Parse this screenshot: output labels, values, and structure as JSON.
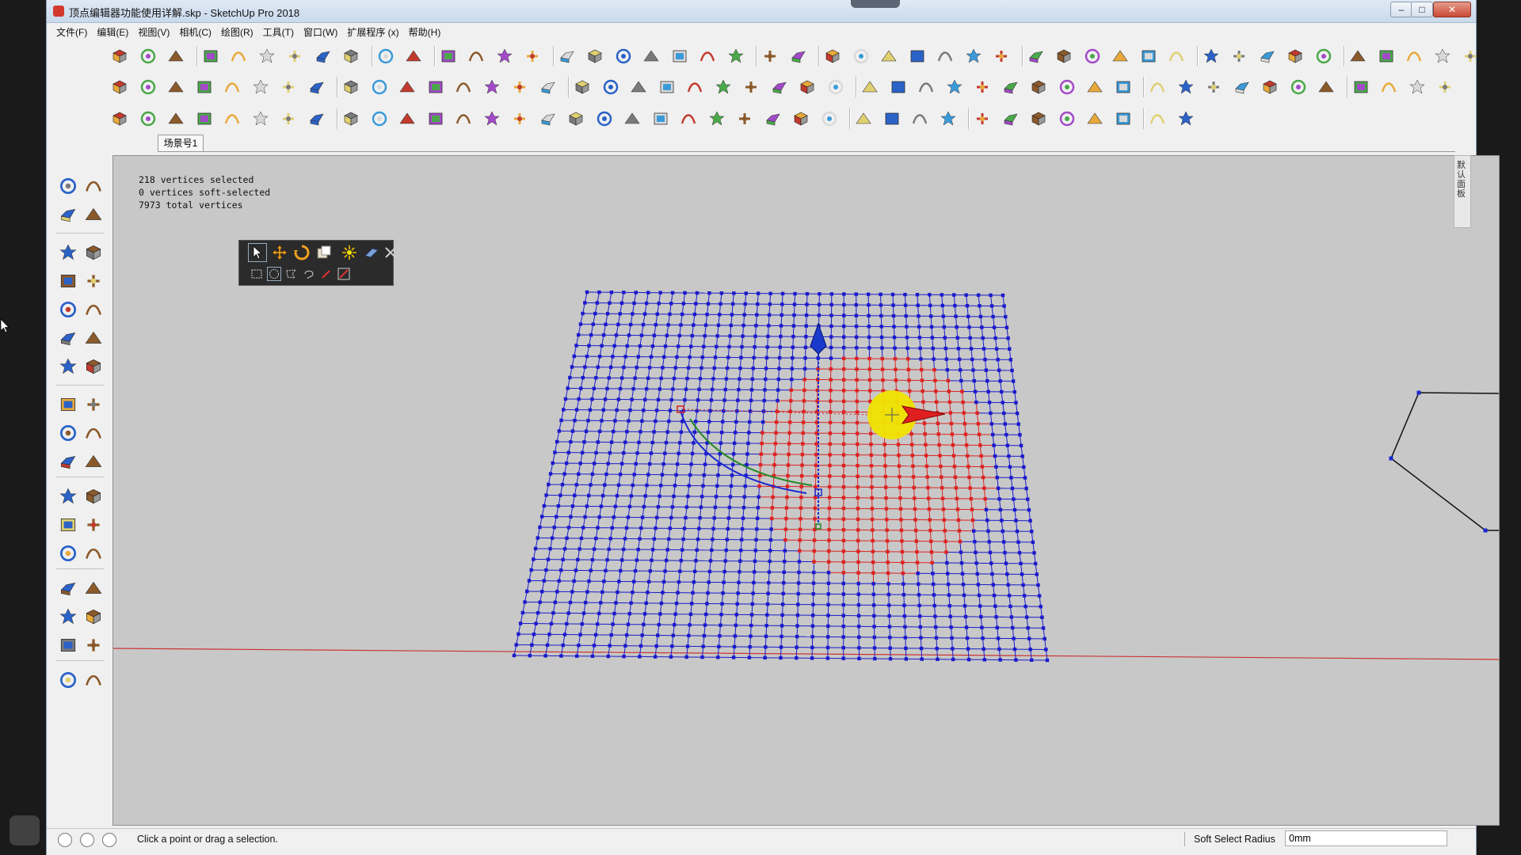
{
  "window": {
    "title": "顶点编辑器功能使用详解.skp - SketchUp Pro 2018",
    "controls": {
      "minimize": "–",
      "maximize": "□",
      "close": "✕"
    }
  },
  "menubar": {
    "items": [
      "文件(F)",
      "编辑(E)",
      "视图(V)",
      "相机(C)",
      "绘图(R)",
      "工具(T)",
      "窗口(W)",
      "扩展程序 (x)",
      "帮助(H)"
    ]
  },
  "scene_tab": {
    "label": "场景号1"
  },
  "viewport": {
    "vertex_info": {
      "selected": "218 vertices selected",
      "soft_selected": "0 vertices soft-selected",
      "total": "7973 total vertices"
    },
    "mesh": {
      "rows": 34,
      "cols": 34,
      "grid_color": "#1a1acc",
      "soft_select_color": "#dd2222"
    },
    "colors": {
      "background": "#c8c8c8",
      "red_axis": "#cc3333",
      "blue_axis": "#1a3acc",
      "gizmo_yellow": "#f0e400"
    }
  },
  "right_dock": {
    "label": "默认面板"
  },
  "statusbar": {
    "prompt": "Click a point or drag a selection.",
    "soft_select_radius_label": "Soft Select Radius",
    "soft_select_radius_value": "0mm"
  },
  "icons": {
    "toolbar": "sketchup-toolbar-icons",
    "tools": [
      "select-icon",
      "component-icon",
      "paint-bucket-icon",
      "eraser-icon",
      "line-icon",
      "freehand-icon",
      "rectangle-icon",
      "rotated-rectangle-icon",
      "circle-icon",
      "polygon-icon",
      "arc-icon",
      "pie-icon",
      "move-icon",
      "push-pull-icon",
      "rotate-icon",
      "follow-me-icon",
      "scale-icon",
      "offset-icon",
      "tape-measure-icon",
      "dimension-icon",
      "protractor-icon",
      "text-icon",
      "axes-icon",
      "3d-text-icon",
      "orbit-icon",
      "pan-icon",
      "zoom-icon",
      "zoom-window-icon",
      "zoom-extents-icon",
      "previous-view-icon",
      "position-camera-icon",
      "look-around-icon",
      "walk-icon",
      "section-plane-icon"
    ]
  }
}
